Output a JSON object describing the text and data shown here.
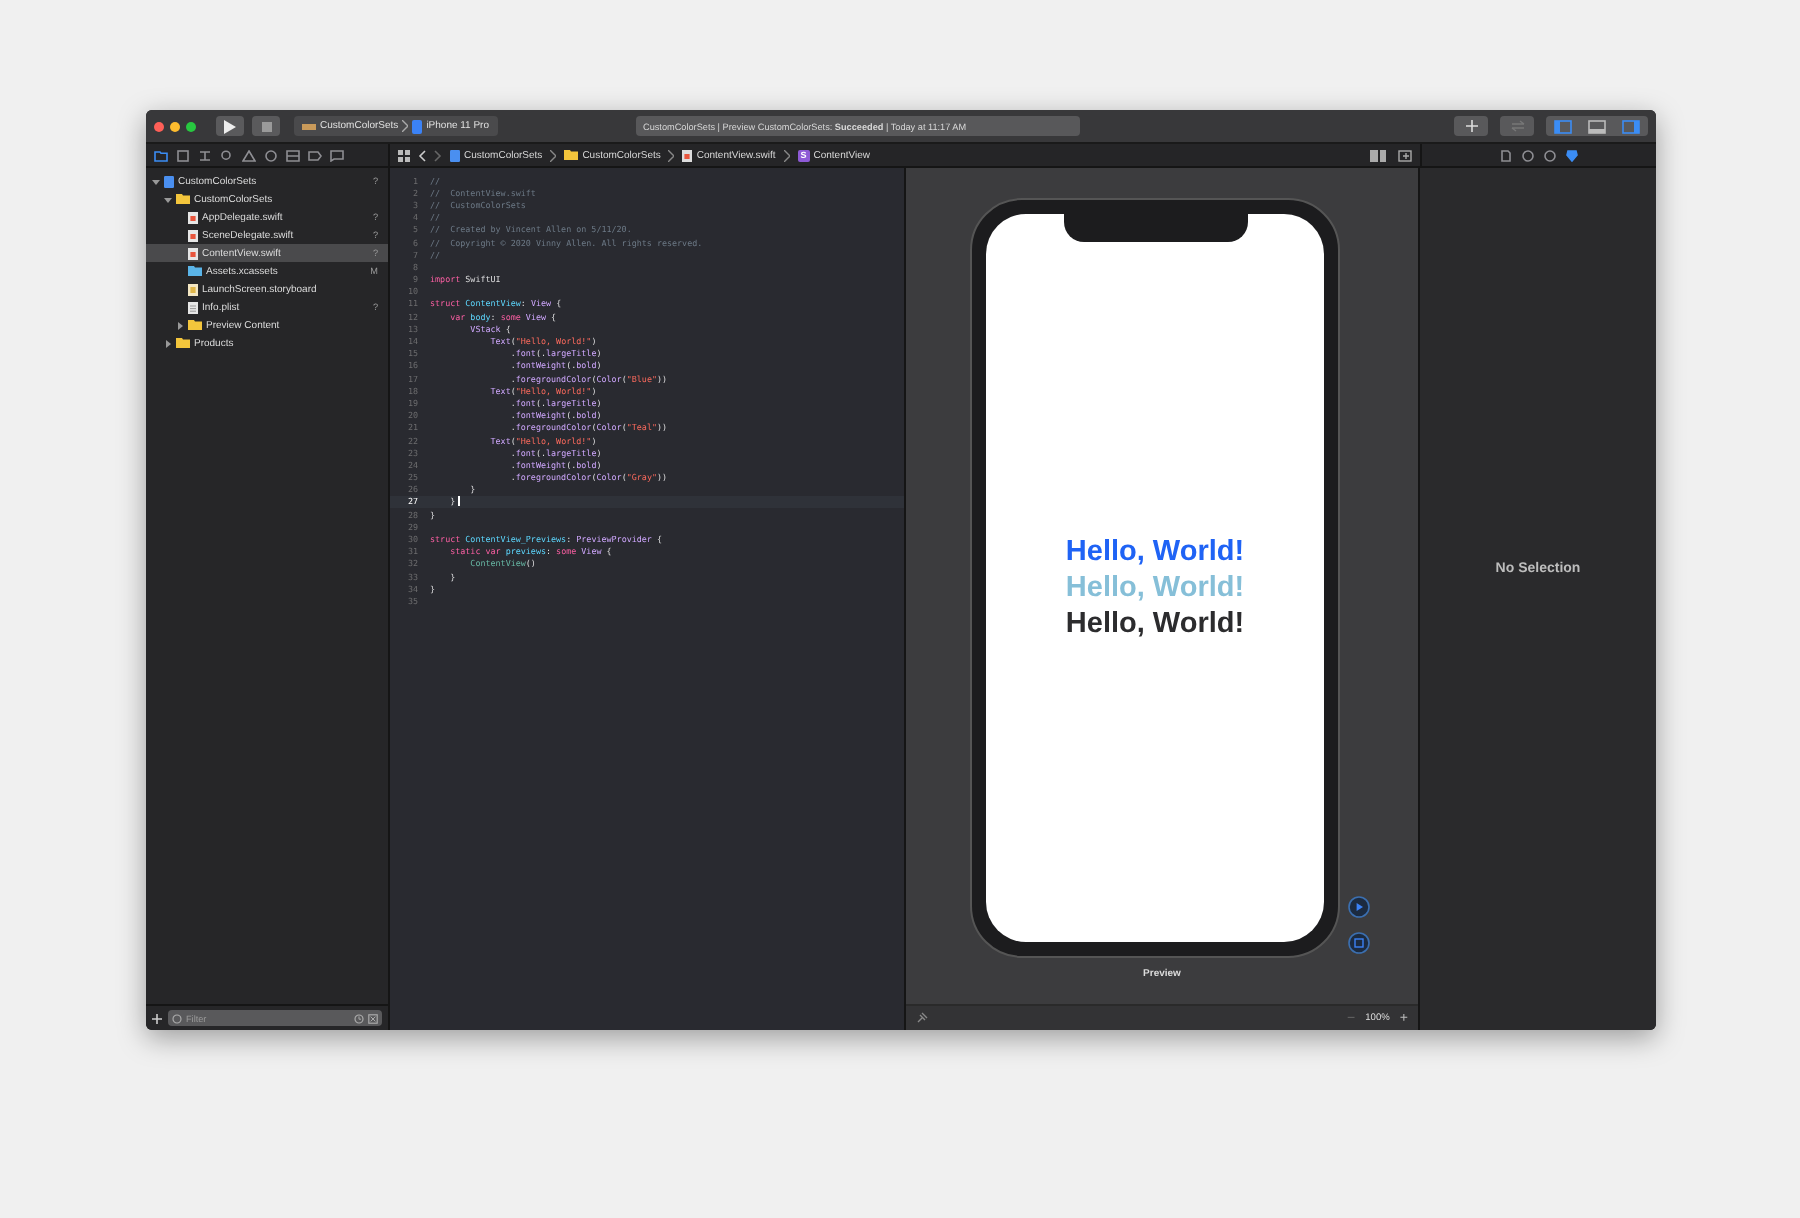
{
  "toolbar": {
    "scheme": "CustomColorSets",
    "device": "iPhone 11 Pro",
    "activity": "CustomColorSets | Preview CustomColorSets: **Succeeded** | Today at 11:17 AM",
    "layout_toggles": [
      {
        "selected": true
      },
      {
        "selected": false
      },
      {
        "selected": true
      }
    ]
  },
  "navigator": {
    "tabs": [
      {
        "selected": true
      },
      {
        "selected": false
      },
      {
        "selected": false
      },
      {
        "selected": false
      },
      {
        "selected": false
      },
      {
        "selected": false
      },
      {
        "selected": false
      },
      {
        "selected": false
      },
      {
        "selected": false
      }
    ],
    "items": [
      {
        "kind": "project",
        "name": "CustomColorSets",
        "badge": "?",
        "selected": false,
        "expanded": true,
        "children": [
          {
            "kind": "folder",
            "name": "CustomColorSets",
            "selected": false,
            "expanded": true,
            "children": [
              {
                "kind": "swift",
                "name": "AppDelegate.swift",
                "badge": "?",
                "selected": false
              },
              {
                "kind": "swift",
                "name": "SceneDelegate.swift",
                "badge": "?",
                "selected": false
              },
              {
                "kind": "swift",
                "name": "ContentView.swift",
                "badge": "?",
                "selected": true
              },
              {
                "kind": "assets",
                "name": "Assets.xcassets",
                "badge": "M",
                "selected": false
              },
              {
                "kind": "storyboard",
                "name": "LaunchScreen.storyboard",
                "selected": false
              },
              {
                "kind": "plist",
                "name": "Info.plist",
                "badge": "?",
                "selected": false
              },
              {
                "kind": "folder",
                "name": "Preview Content",
                "selected": false,
                "expanded": false
              }
            ]
          },
          {
            "kind": "folder",
            "name": "Products",
            "selected": false,
            "expanded": false
          }
        ]
      }
    ],
    "filter": {
      "placeholder": "Filter"
    }
  },
  "jump_bar": {
    "crumbs": [
      {
        "kind": "project",
        "label": "CustomColorSets"
      },
      {
        "kind": "folder",
        "label": "CustomColorSets"
      },
      {
        "kind": "swift",
        "label": "ContentView.swift"
      },
      {
        "kind": "struct",
        "label": "ContentView",
        "icon_text": "S"
      }
    ]
  },
  "editor": {
    "lines": [
      {
        "n": "1",
        "current": false,
        "tokens": [
          {
            "kind": "comment",
            "text": "//"
          }
        ]
      },
      {
        "n": "2",
        "current": false,
        "tokens": [
          {
            "kind": "comment",
            "text": "//  ContentView.swift"
          }
        ]
      },
      {
        "n": "3",
        "current": false,
        "tokens": [
          {
            "kind": "comment",
            "text": "//  CustomColorSets"
          }
        ]
      },
      {
        "n": "4",
        "current": false,
        "tokens": [
          {
            "kind": "comment",
            "text": "//"
          }
        ]
      },
      {
        "n": "5",
        "current": false,
        "tokens": [
          {
            "kind": "comment",
            "text": "//  Created by Vincent Allen on 5/11/20."
          }
        ]
      },
      {
        "n": "6",
        "current": false,
        "tokens": [
          {
            "kind": "comment",
            "text": "//  Copyright © 2020 Vinny Allen. All rights reserved."
          }
        ]
      },
      {
        "n": "7",
        "current": false,
        "tokens": [
          {
            "kind": "comment",
            "text": "//"
          }
        ]
      },
      {
        "n": "8",
        "current": false
      },
      {
        "n": "9",
        "current": false,
        "tokens": [
          {
            "kind": "keyword",
            "text": "import"
          },
          {
            "kind": "plain",
            "text": " SwiftUI"
          }
        ]
      },
      {
        "n": "10",
        "current": false
      },
      {
        "n": "11",
        "current": false,
        "tokens": [
          {
            "kind": "keyword",
            "text": "struct"
          },
          {
            "kind": "name",
            "text": " ContentView"
          },
          {
            "kind": "plain",
            "text": ": "
          },
          {
            "kind": "type",
            "text": "View"
          },
          {
            "kind": "plain",
            "text": " {"
          }
        ]
      },
      {
        "n": "12",
        "current": false,
        "tokens": [
          {
            "kind": "keyword",
            "text": "    var"
          },
          {
            "kind": "name",
            "text": " body"
          },
          {
            "kind": "plain",
            "text": ": "
          },
          {
            "kind": "keyword",
            "text": "some"
          },
          {
            "kind": "type",
            "text": " View"
          },
          {
            "kind": "plain",
            "text": " {"
          }
        ]
      },
      {
        "n": "13",
        "current": false,
        "tokens": [
          {
            "kind": "type",
            "text": "        VStack"
          },
          {
            "kind": "plain",
            "text": " {"
          }
        ]
      },
      {
        "n": "14",
        "current": false,
        "tokens": [
          {
            "kind": "type",
            "text": "            Text"
          },
          {
            "kind": "plain",
            "text": "("
          },
          {
            "kind": "string",
            "text": "\"Hello, World!\""
          },
          {
            "kind": "plain",
            "text": ")"
          }
        ]
      },
      {
        "n": "15",
        "current": false,
        "tokens": [
          {
            "kind": "plain",
            "text": "                ."
          },
          {
            "kind": "type",
            "text": "font"
          },
          {
            "kind": "plain",
            "text": "(."
          },
          {
            "kind": "type",
            "text": "largeTitle"
          },
          {
            "kind": "plain",
            "text": ")"
          }
        ]
      },
      {
        "n": "16",
        "current": false,
        "tokens": [
          {
            "kind": "plain",
            "text": "                ."
          },
          {
            "kind": "type",
            "text": "fontWeight"
          },
          {
            "kind": "plain",
            "text": "(."
          },
          {
            "kind": "type",
            "text": "bold"
          },
          {
            "kind": "plain",
            "text": ")"
          }
        ]
      },
      {
        "n": "17",
        "current": false,
        "tokens": [
          {
            "kind": "plain",
            "text": "                ."
          },
          {
            "kind": "type",
            "text": "foregroundColor"
          },
          {
            "kind": "plain",
            "text": "("
          },
          {
            "kind": "type",
            "text": "Color"
          },
          {
            "kind": "plain",
            "text": "("
          },
          {
            "kind": "string",
            "text": "\"Blue\""
          },
          {
            "kind": "plain",
            "text": "))"
          }
        ]
      },
      {
        "n": "18",
        "current": false,
        "tokens": [
          {
            "kind": "type",
            "text": "            Text"
          },
          {
            "kind": "plain",
            "text": "("
          },
          {
            "kind": "string",
            "text": "\"Hello, World!\""
          },
          {
            "kind": "plain",
            "text": ")"
          }
        ]
      },
      {
        "n": "19",
        "current": false,
        "tokens": [
          {
            "kind": "plain",
            "text": "                ."
          },
          {
            "kind": "type",
            "text": "font"
          },
          {
            "kind": "plain",
            "text": "(."
          },
          {
            "kind": "type",
            "text": "largeTitle"
          },
          {
            "kind": "plain",
            "text": ")"
          }
        ]
      },
      {
        "n": "20",
        "current": false,
        "tokens": [
          {
            "kind": "plain",
            "text": "                ."
          },
          {
            "kind": "type",
            "text": "fontWeight"
          },
          {
            "kind": "plain",
            "text": "(."
          },
          {
            "kind": "type",
            "text": "bold"
          },
          {
            "kind": "plain",
            "text": ")"
          }
        ]
      },
      {
        "n": "21",
        "current": false,
        "tokens": [
          {
            "kind": "plain",
            "text": "                ."
          },
          {
            "kind": "type",
            "text": "foregroundColor"
          },
          {
            "kind": "plain",
            "text": "("
          },
          {
            "kind": "type",
            "text": "Color"
          },
          {
            "kind": "plain",
            "text": "("
          },
          {
            "kind": "string",
            "text": "\"Teal\""
          },
          {
            "kind": "plain",
            "text": "))"
          }
        ]
      },
      {
        "n": "22",
        "current": false,
        "tokens": [
          {
            "kind": "type",
            "text": "            Text"
          },
          {
            "kind": "plain",
            "text": "("
          },
          {
            "kind": "string",
            "text": "\"Hello, World!\""
          },
          {
            "kind": "plain",
            "text": ")"
          }
        ]
      },
      {
        "n": "23",
        "current": false,
        "tokens": [
          {
            "kind": "plain",
            "text": "                ."
          },
          {
            "kind": "type",
            "text": "font"
          },
          {
            "kind": "plain",
            "text": "(."
          },
          {
            "kind": "type",
            "text": "largeTitle"
          },
          {
            "kind": "plain",
            "text": ")"
          }
        ]
      },
      {
        "n": "24",
        "current": false,
        "tokens": [
          {
            "kind": "plain",
            "text": "                ."
          },
          {
            "kind": "type",
            "text": "fontWeight"
          },
          {
            "kind": "plain",
            "text": "(."
          },
          {
            "kind": "type",
            "text": "bold"
          },
          {
            "kind": "plain",
            "text": ")"
          }
        ]
      },
      {
        "n": "25",
        "current": false,
        "tokens": [
          {
            "kind": "plain",
            "text": "                ."
          },
          {
            "kind": "type",
            "text": "foregroundColor"
          },
          {
            "kind": "plain",
            "text": "("
          },
          {
            "kind": "type",
            "text": "Color"
          },
          {
            "kind": "plain",
            "text": "("
          },
          {
            "kind": "string",
            "text": "\"Gray\""
          },
          {
            "kind": "plain",
            "text": "))"
          }
        ]
      },
      {
        "n": "26",
        "current": false,
        "tokens": [
          {
            "kind": "plain",
            "text": "        }"
          }
        ]
      },
      {
        "n": "27",
        "current": true,
        "tokens": [
          {
            "kind": "plain",
            "text": "    }"
          }
        ]
      },
      {
        "n": "28",
        "current": false,
        "tokens": [
          {
            "kind": "plain",
            "text": "}"
          }
        ]
      },
      {
        "n": "29",
        "current": false
      },
      {
        "n": "30",
        "current": false,
        "tokens": [
          {
            "kind": "keyword",
            "text": "struct"
          },
          {
            "kind": "name",
            "text": " ContentView_Previews"
          },
          {
            "kind": "plain",
            "text": ": "
          },
          {
            "kind": "type",
            "text": "PreviewProvider"
          },
          {
            "kind": "plain",
            "text": " {"
          }
        ]
      },
      {
        "n": "31",
        "current": false,
        "tokens": [
          {
            "kind": "keyword",
            "text": "    static var"
          },
          {
            "kind": "name",
            "text": " previews"
          },
          {
            "kind": "plain",
            "text": ": "
          },
          {
            "kind": "keyword",
            "text": "some"
          },
          {
            "kind": "type",
            "text": " View"
          },
          {
            "kind": "plain",
            "text": " {"
          }
        ]
      },
      {
        "n": "32",
        "current": false,
        "tokens": [
          {
            "kind": "call",
            "text": "        ContentView"
          },
          {
            "kind": "plain",
            "text": "()"
          }
        ]
      },
      {
        "n": "33",
        "current": false,
        "tokens": [
          {
            "kind": "plain",
            "text": "    }"
          }
        ]
      },
      {
        "n": "34",
        "current": false,
        "tokens": [
          {
            "kind": "plain",
            "text": "}"
          }
        ]
      },
      {
        "n": "35",
        "current": false
      }
    ]
  },
  "preview": {
    "texts": [
      {
        "text": "Hello, World!",
        "color": "#1f63f5"
      },
      {
        "text": "Hello, World!",
        "color": "#86bfd8"
      },
      {
        "text": "Hello, World!",
        "color": "#2c2c2e"
      }
    ],
    "label": "Preview",
    "zoom": "100%",
    "zoom_out": "−",
    "zoom_in": "+"
  },
  "inspector": {
    "tabs": [
      {
        "selected": false
      },
      {
        "selected": false
      },
      {
        "selected": false
      },
      {
        "selected": true
      }
    ],
    "empty_text": "No Selection"
  }
}
